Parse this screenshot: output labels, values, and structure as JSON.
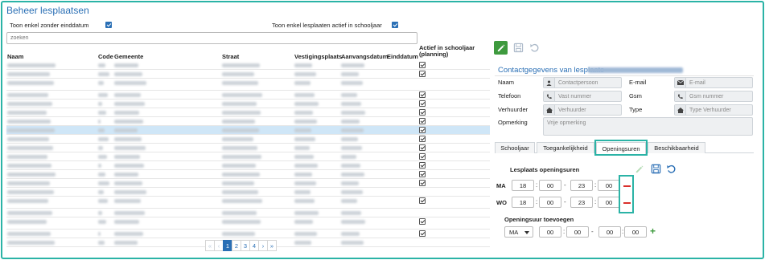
{
  "title": "Beheer lesplaatsen",
  "filters": {
    "no_enddate_label": "Toon enkel zonder einddatum",
    "active_label": "Toon enkel lesplaaten actief in schooljaar"
  },
  "search": {
    "placeholder": "zoeken"
  },
  "table": {
    "headers": {
      "naam": "Naam",
      "code": "Code",
      "gemeente": "Gemeente",
      "straat": "Straat",
      "vestigingsplaats": "Vestigingsplaats",
      "aanvangsdatum": "Aanvangsdatum",
      "einddatum": "Einddatum",
      "actief": "Actief in schooljaar (planning)"
    }
  },
  "pager": {
    "first": "«",
    "prev": "‹",
    "pages": [
      "1",
      "2",
      "3",
      "4"
    ],
    "next": "›",
    "last": "»",
    "current_page": 1
  },
  "contact": {
    "title": "Contactgegevens van lesplaats",
    "labels": {
      "naam": "Naam",
      "email": "E-mail",
      "telefoon": "Telefoon",
      "gsm": "Gsm",
      "verhuurder": "Verhuurder",
      "type": "Type",
      "opmerking": "Opmerking"
    },
    "placeholders": {
      "contactpersoon": "Contactpersoon",
      "email": "E-mail",
      "vast": "Vast nummer",
      "gsm": "Gsm nummer",
      "verhuurder": "Verhuurder",
      "type": "Type Verhuurder",
      "opmerking": "Vrije opmerking"
    }
  },
  "tabs": [
    "Schooljaar",
    "Toegankelijkheid",
    "Openingsuren",
    "Beschikbaarheid"
  ],
  "active_tab": "Openingsuren",
  "opening": {
    "section_title": "Lesplaats openingsuren",
    "rows": [
      {
        "day": "MA",
        "from_h": "18",
        "from_m": "00",
        "to_h": "23",
        "to_m": "00"
      },
      {
        "day": "WO",
        "from_h": "18",
        "from_m": "00",
        "to_h": "23",
        "to_m": "00"
      }
    ],
    "add_title": "Openingsuur toevoegen",
    "new_row": {
      "day": "MA",
      "from_h": "00",
      "from_m": "00",
      "to_h": "00",
      "to_m": "00"
    }
  },
  "colors": {
    "accent": "#2a6fb5",
    "highlight": "#2bb3a6",
    "edit": "#3e9a3e",
    "remove": "#d9302c"
  }
}
